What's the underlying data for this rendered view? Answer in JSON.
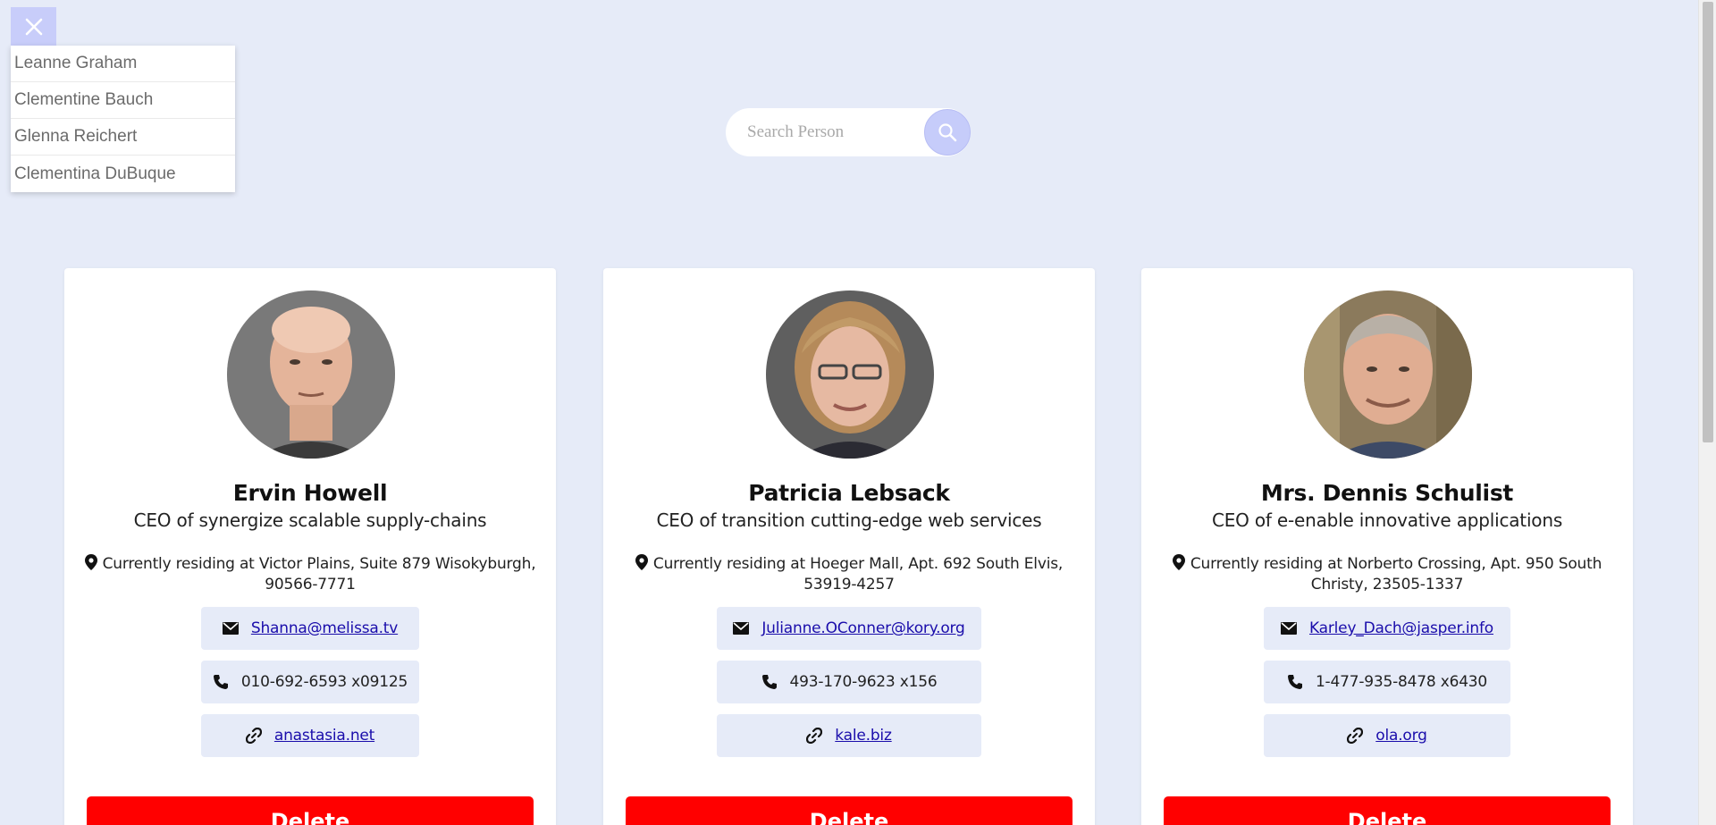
{
  "overlay": {
    "close_icon": "close-icon",
    "names": [
      "Leanne Graham",
      "Clementine Bauch",
      "Glenna Reichert",
      "Clementina DuBuque"
    ]
  },
  "search": {
    "placeholder": "Search Person",
    "value": "",
    "icon": "search-icon"
  },
  "colors": {
    "background": "#e6ebf8",
    "accent": "#c6ccfa",
    "delete": "#ff0000",
    "link": "#1a0dab"
  },
  "cards": [
    {
      "name": "Ervin Howell",
      "role": "CEO of synergize scalable supply-chains",
      "address": "Currently residing at Victor Plains, Suite 879 Wisokyburgh, 90566-7771",
      "email": "Shanna@melissa.tv",
      "phone": "010-692-6593 x09125",
      "website": "anastasia.net",
      "delete_label": "Delete"
    },
    {
      "name": "Patricia Lebsack",
      "role": "CEO of transition cutting-edge web services",
      "address": "Currently residing at Hoeger Mall, Apt. 692 South Elvis, 53919-4257",
      "email": "Julianne.OConner@kory.org",
      "phone": "493-170-9623 x156",
      "website": "kale.biz",
      "delete_label": "Delete"
    },
    {
      "name": "Mrs. Dennis Schulist",
      "role": "CEO of e-enable innovative applications",
      "address": "Currently residing at Norberto Crossing, Apt. 950 South Christy, 23505-1337",
      "email": "Karley_Dach@jasper.info",
      "phone": "1-477-935-8478 x6430",
      "website": "ola.org",
      "delete_label": "Delete"
    }
  ]
}
